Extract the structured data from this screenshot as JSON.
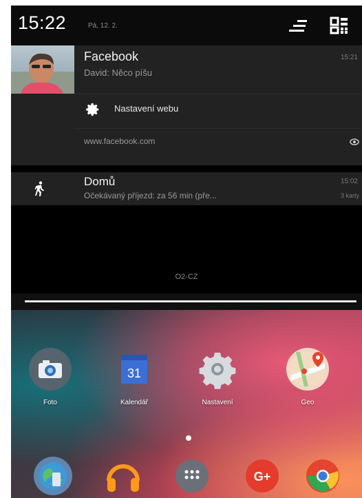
{
  "status_bar": {
    "time": "15:22",
    "date": "Pá, 12. 2."
  },
  "notifications": {
    "facebook": {
      "title": "Facebook",
      "time": "15:21",
      "message": "David: Něco píšu",
      "action_label": "Nastavení webu",
      "url": "www.facebook.com"
    },
    "home": {
      "title": "Domů",
      "time": "15:02",
      "message": "Očekávaný příjezd: za 56 min (pře...",
      "sub": "3 karty"
    }
  },
  "carrier": "O2-CZ",
  "apps": [
    {
      "label": "Foto",
      "icon": "camera-icon"
    },
    {
      "label": "Kalendář",
      "icon": "calendar-icon",
      "badge": "31"
    },
    {
      "label": "Nastavení",
      "icon": "settings-gear-icon"
    },
    {
      "label": "Geo",
      "icon": "maps-icon"
    }
  ],
  "dock": [
    {
      "icon": "phone-globe-icon"
    },
    {
      "icon": "headphones-icon"
    },
    {
      "icon": "app-drawer-icon"
    },
    {
      "icon": "google-plus-icon",
      "text": "G+"
    },
    {
      "icon": "chrome-icon"
    }
  ],
  "colors": {
    "notification_bg": "#222222",
    "screen_bg": "#000000",
    "calendar_blue": "#3b6fd6",
    "gplus_red": "#e53b2c"
  }
}
